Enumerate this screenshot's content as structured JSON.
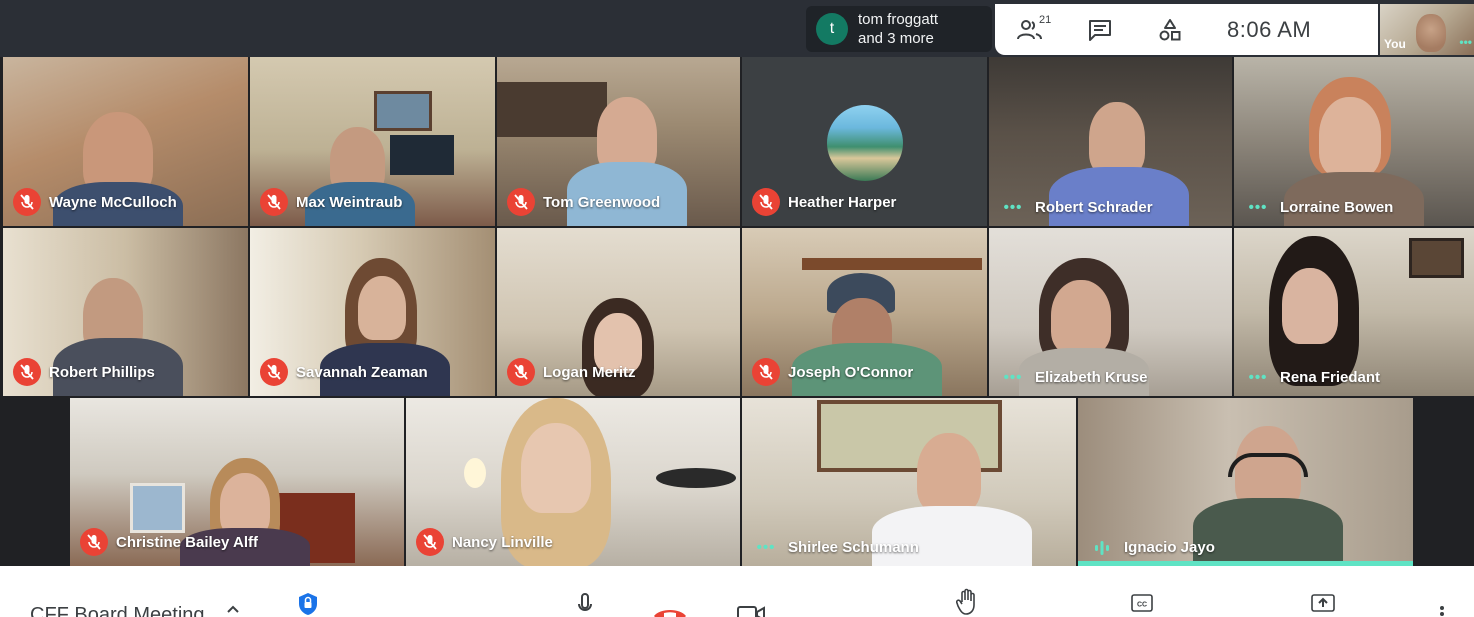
{
  "presenter": {
    "avatar_letter": "t",
    "line1": "tom froggatt",
    "line2": "and 3 more"
  },
  "top_controls": {
    "people_count": "21",
    "time": "8:06 AM"
  },
  "self_view": {
    "label": "You"
  },
  "participants": [
    {
      "name": "Wayne McCulloch",
      "status": "muted"
    },
    {
      "name": "Max Weintraub",
      "status": "muted"
    },
    {
      "name": "Tom Greenwood",
      "status": "muted"
    },
    {
      "name": "Heather Harper",
      "status": "muted"
    },
    {
      "name": "Robert Schrader",
      "status": "active"
    },
    {
      "name": "Lorraine Bowen",
      "status": "active"
    },
    {
      "name": "Robert Phillips",
      "status": "muted"
    },
    {
      "name": "Savannah Zeaman",
      "status": "muted"
    },
    {
      "name": "Logan Meritz",
      "status": "muted"
    },
    {
      "name": "Joseph O'Connor",
      "status": "muted"
    },
    {
      "name": "Elizabeth Kruse",
      "status": "active"
    },
    {
      "name": "Rena Friedant",
      "status": "active"
    },
    {
      "name": "Christine Bailey Alff",
      "status": "muted"
    },
    {
      "name": "Nancy Linville",
      "status": "muted"
    },
    {
      "name": "Shirlee Schumann",
      "status": "active"
    },
    {
      "name": "Ignacio Jayo",
      "status": "speaking"
    }
  ],
  "meeting": {
    "title": "CFF Board Meeting"
  },
  "colors": {
    "accent": "#5fe3c4",
    "mute_red": "#ea4335",
    "hangup_red": "#ea4335",
    "security_blue": "#1a73e8"
  },
  "icons": [
    "people-icon",
    "chat-icon",
    "activities-icon",
    "mic-off-icon",
    "more-dots-icon",
    "speaking-icon",
    "chevron-up-icon",
    "security-icon",
    "mic-icon",
    "hangup-icon",
    "camera-icon",
    "raise-hand-icon",
    "captions-icon",
    "present-icon",
    "more-vert-icon"
  ]
}
